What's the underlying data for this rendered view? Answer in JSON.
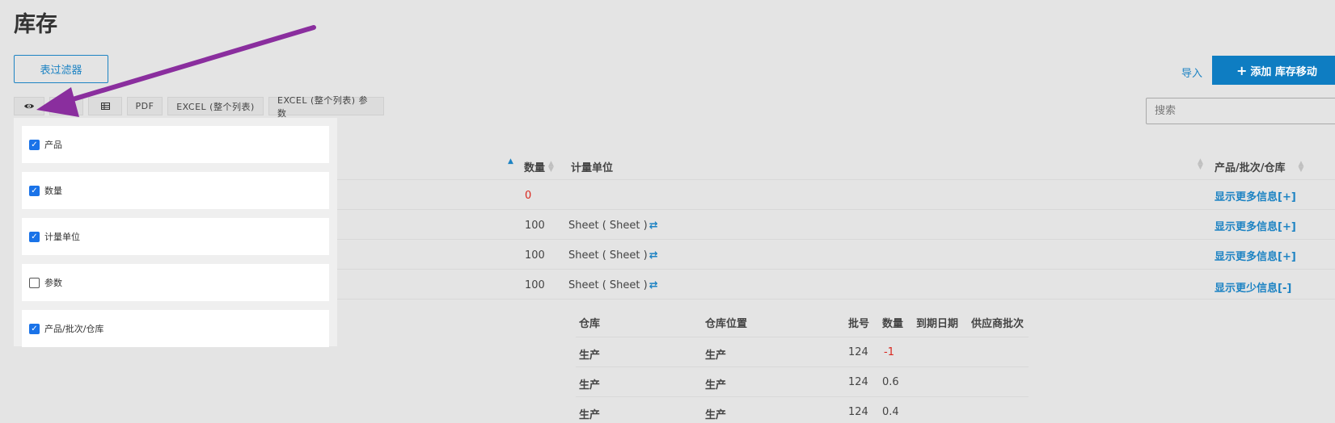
{
  "page": {
    "title": "库存"
  },
  "header": {
    "filter_button": "表过滤器",
    "import_link": "导入",
    "add_button": "添加 库存移动"
  },
  "toolbar": {
    "buttons": [
      "",
      "",
      "",
      "PDF",
      "EXCEL (整个列表)",
      "EXCEL (整个列表) 参数"
    ],
    "icons": [
      "eye-icon",
      "copy-icon",
      "table-icon"
    ]
  },
  "search": {
    "placeholder": "搜索",
    "value": ""
  },
  "column_menu": {
    "items": [
      {
        "label": "产品",
        "checked": true
      },
      {
        "label": "数量",
        "checked": true
      },
      {
        "label": "计量单位",
        "checked": true
      },
      {
        "label": "参数",
        "checked": false
      },
      {
        "label": "产品/批次/仓库",
        "checked": true
      }
    ]
  },
  "table": {
    "headers": {
      "quantity": "数量",
      "unit": "计量单位",
      "product_lot_warehouse": "产品/批次/仓库"
    },
    "rows": [
      {
        "quantity": "0",
        "unit": "",
        "more": "显示更多信息[+]"
      },
      {
        "quantity": "100",
        "unit": "Sheet ( Sheet )",
        "more": "显示更多信息[+]"
      },
      {
        "quantity": "100",
        "unit": "Sheet ( Sheet )",
        "more": "显示更多信息[+]"
      },
      {
        "quantity": "100",
        "unit": "Sheet ( Sheet )",
        "more": "显示更少信息[-]"
      }
    ]
  },
  "subtable": {
    "headers": [
      "仓库",
      "仓库位置",
      "批号",
      "数量",
      "到期日期",
      "供应商批次"
    ],
    "rows": [
      [
        "生产",
        "生产",
        "124",
        "-1",
        "",
        ""
      ],
      [
        "生产",
        "生产",
        "124",
        "0.6",
        "",
        ""
      ],
      [
        "生产",
        "生产",
        "124",
        "0.4",
        "",
        ""
      ]
    ]
  },
  "colors": {
    "accent": "#1d83c3",
    "annotation_arrow": "#8a2e9e",
    "negative": "#d9281f"
  }
}
